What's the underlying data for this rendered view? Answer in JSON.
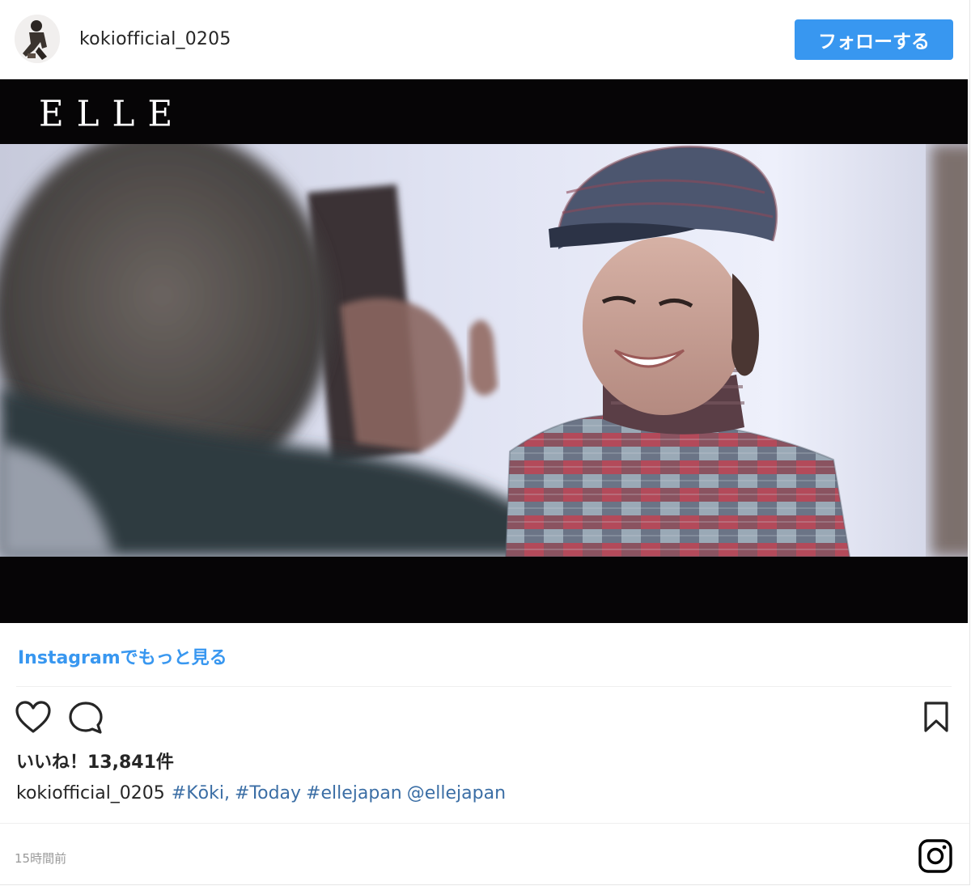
{
  "header": {
    "username": "kokiofficial_0205",
    "follow_label": "フォローする"
  },
  "media": {
    "logo_text": "ELLE"
  },
  "more_link": "Instagramでもっと見る",
  "actions": {
    "like_icon": "heart-icon",
    "comment_icon": "comment-icon",
    "save_icon": "bookmark-icon"
  },
  "likes": {
    "label": "いいね！13,841件"
  },
  "caption": {
    "username": "kokiofficial_0205",
    "tags": [
      "#Kōki,",
      "#Today",
      "#ellejapan",
      "@ellejapan"
    ]
  },
  "timestamp": "15時間前",
  "colors": {
    "accent": "#3897f0",
    "hashtag": "#3b6ea5",
    "media_bg": "#060506"
  }
}
